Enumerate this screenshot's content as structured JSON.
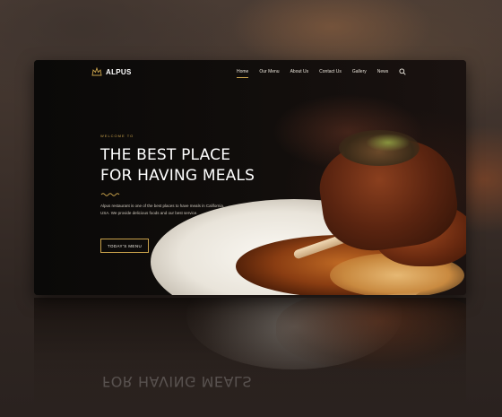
{
  "nav": {
    "brand": "ALPUS",
    "items": [
      {
        "label": "Home",
        "active": true
      },
      {
        "label": "Our Menu",
        "active": false
      },
      {
        "label": "About Us",
        "active": false
      },
      {
        "label": "Contact Us",
        "active": false
      },
      {
        "label": "Gallery",
        "active": false
      },
      {
        "label": "News",
        "active": false
      }
    ],
    "search_icon": "search-icon"
  },
  "hero": {
    "eyebrow": "WELCOME TO",
    "headline_line1": "THE BEST PLACE",
    "headline_line2": "FOR HAVING MEALS",
    "description": "Alpus restaurant is one of the best places to have meals in California, USA. We provide delicious foods and our best service.",
    "cta_label": "TODAY'S MENU"
  },
  "reflection": {
    "text": "FOR HAVING MEALS"
  },
  "colors": {
    "accent": "#c9a24b",
    "background": "#0d0b0a",
    "text": "#ffffff"
  }
}
